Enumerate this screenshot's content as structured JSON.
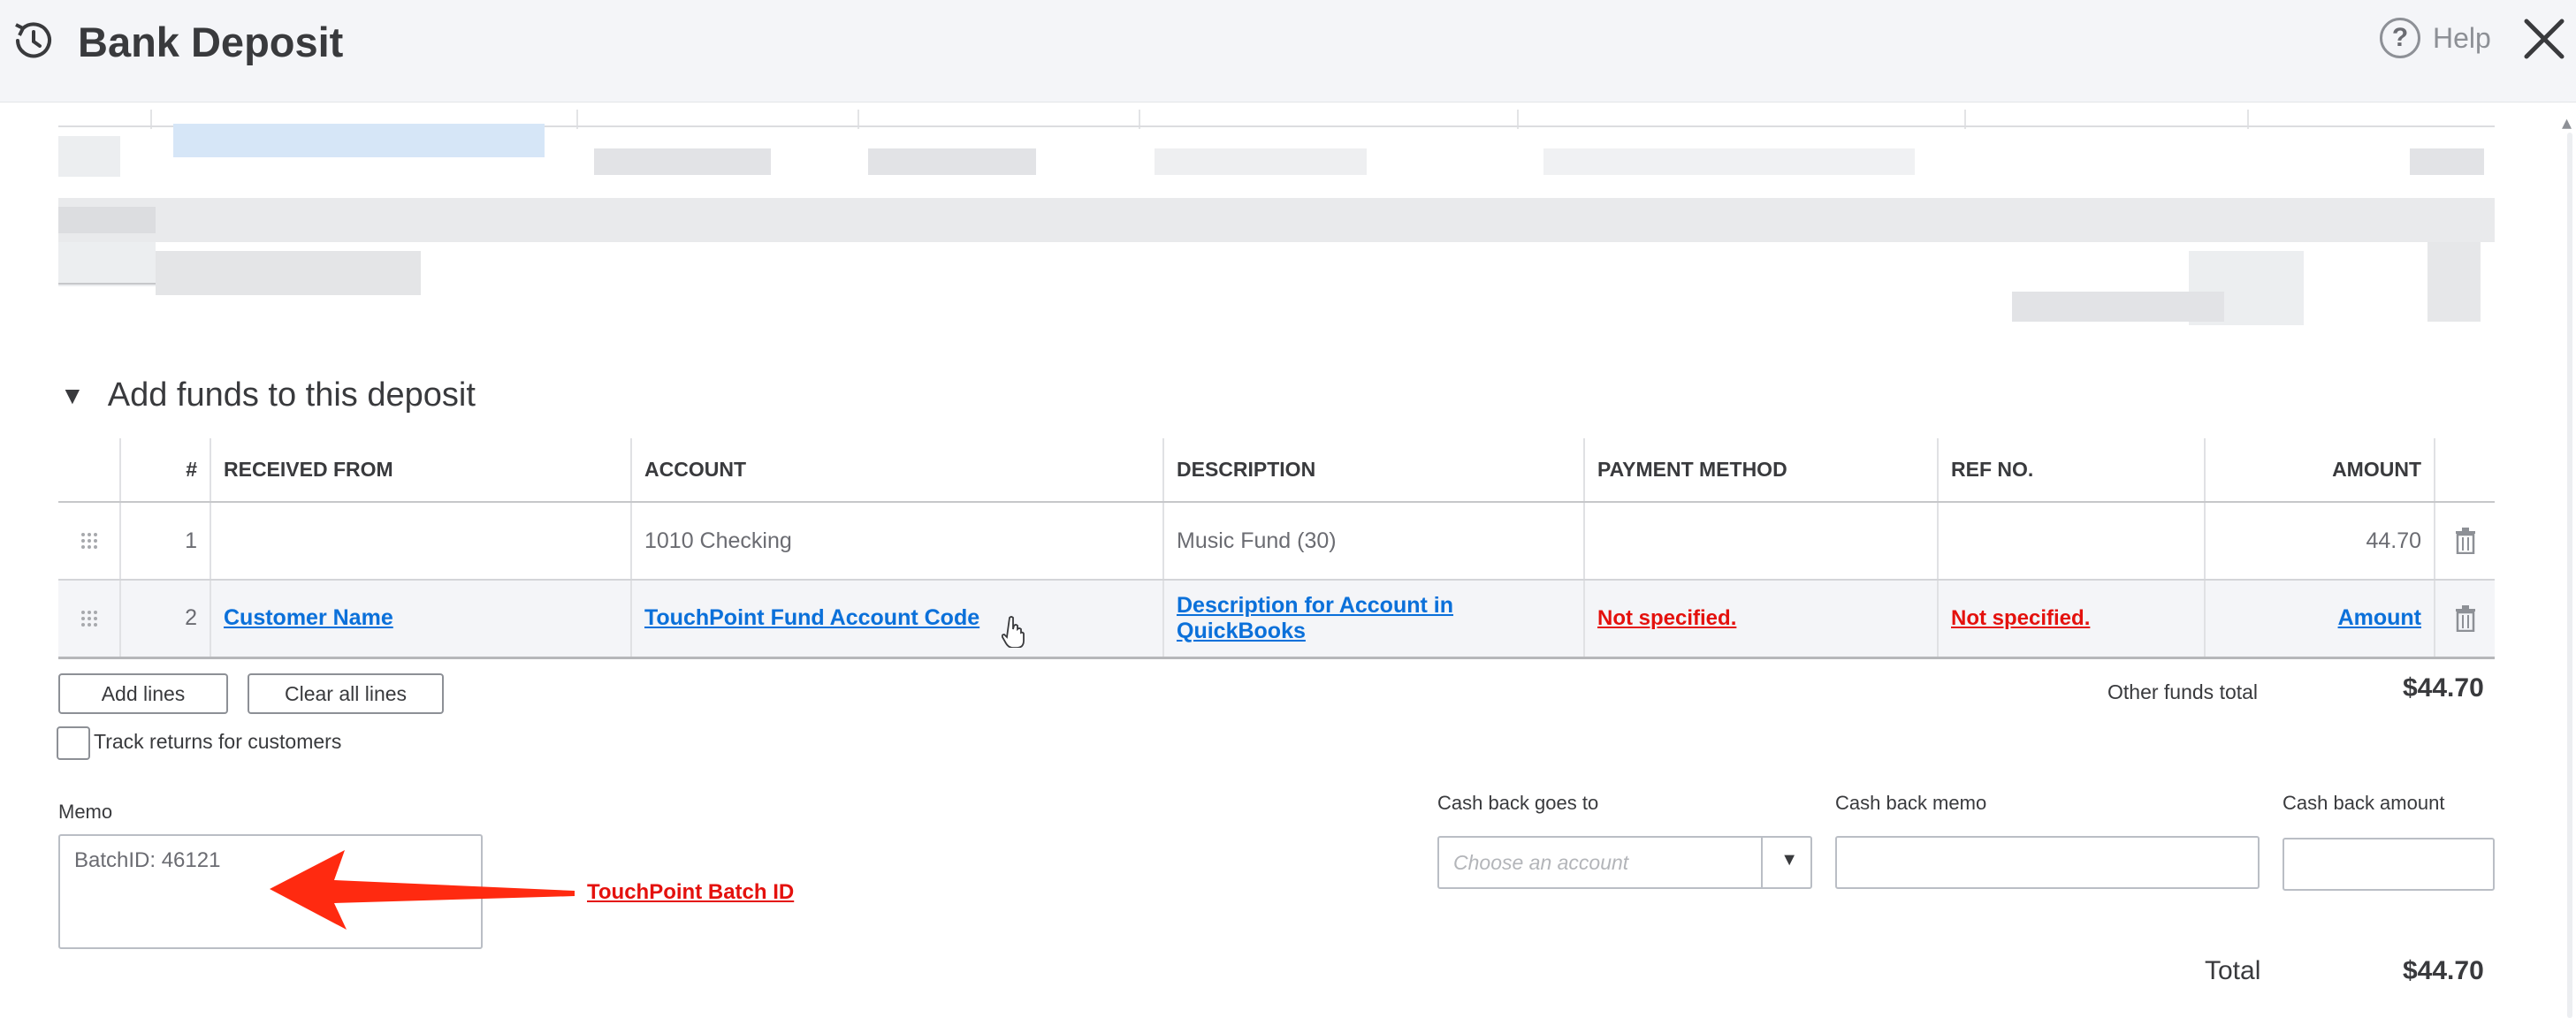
{
  "header": {
    "title": "Bank Deposit",
    "help_label": "Help",
    "icons": {
      "logo": "history-clock-icon",
      "help": "help-circle-icon",
      "close": "close-icon"
    }
  },
  "section": {
    "toggle_icon": "triangle-down-icon",
    "title": "Add funds to this deposit"
  },
  "funds_table": {
    "columns": [
      "#",
      "RECEIVED FROM",
      "ACCOUNT",
      "DESCRIPTION",
      "PAYMENT METHOD",
      "REF NO.",
      "AMOUNT"
    ],
    "rows": [
      {
        "num": "1",
        "received_from": "",
        "account": "1010 Checking",
        "description": "Music Fund (30)",
        "payment_method": "",
        "ref_no": "",
        "amount": "44.70"
      },
      {
        "num": "2",
        "received_from": "Customer Name",
        "account": "TouchPoint Fund Account Code",
        "description": "Description for Account in QuickBooks",
        "payment_method": "Not specified.",
        "ref_no": "Not specified.",
        "amount": "Amount"
      }
    ]
  },
  "buttons": {
    "add_lines": "Add lines",
    "clear_all_lines": "Clear all lines"
  },
  "track_returns_label": "Track returns for customers",
  "other_funds": {
    "label": "Other funds total",
    "value": "$44.70"
  },
  "memo": {
    "label": "Memo",
    "value": "BatchID: 46121"
  },
  "annotations": {
    "batch_id": "TouchPoint Batch ID"
  },
  "cash_back": {
    "goes_to_label": "Cash back goes to",
    "goes_to_placeholder": "Choose an account",
    "memo_label": "Cash back memo",
    "amount_label": "Cash back amount"
  },
  "total": {
    "label": "Total",
    "value": "$44.70"
  },
  "colors": {
    "annotation_blue": "#0b70d9",
    "annotation_red": "#e4110d",
    "header_bg": "#f4f5f8"
  }
}
